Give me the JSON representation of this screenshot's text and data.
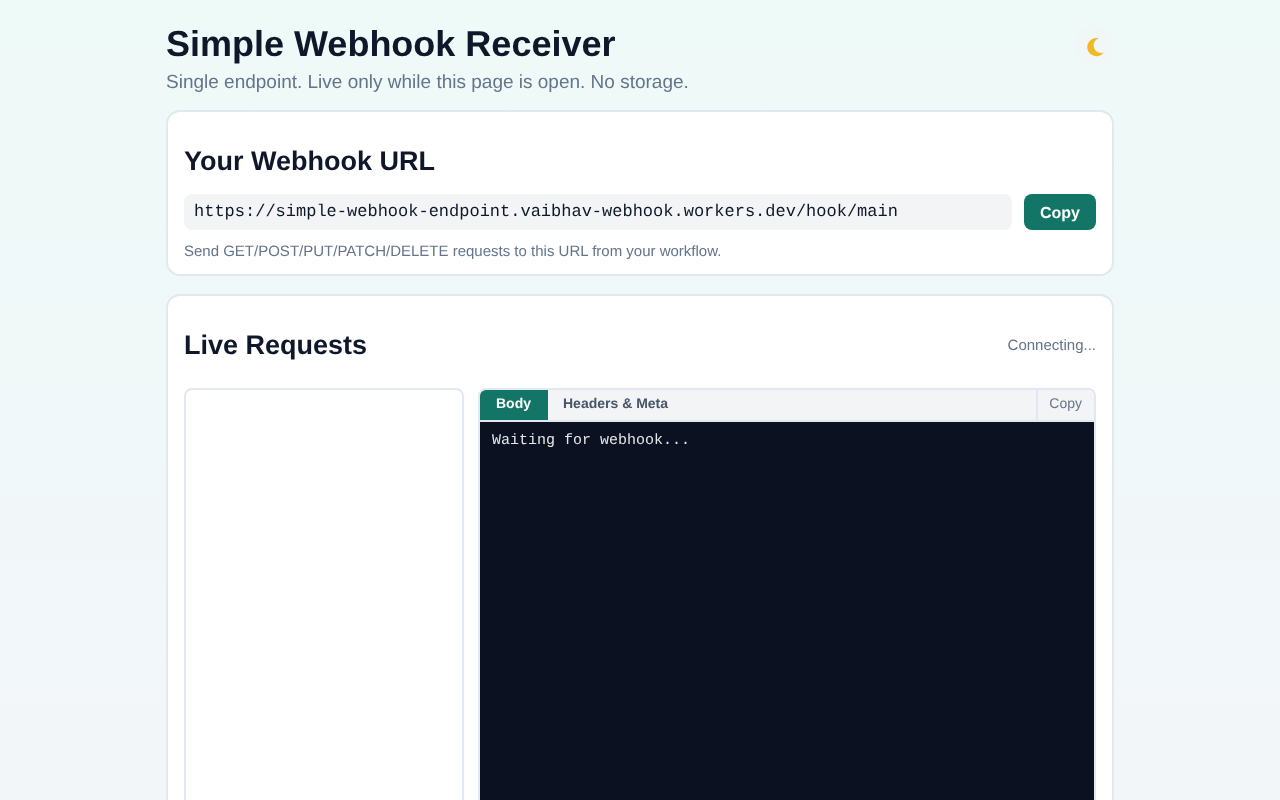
{
  "header": {
    "title": "Simple Webhook Receiver",
    "subtitle": "Single endpoint. Live only while this page is open. No storage."
  },
  "url_card": {
    "title": "Your Webhook URL",
    "url": "https://simple-webhook-endpoint.vaibhav-webhook.workers.dev/hook/main",
    "copy_button": "Copy",
    "hint": "Send GET/POST/PUT/PATCH/DELETE requests to this URL from your workflow."
  },
  "live_card": {
    "title": "Live Requests",
    "status": "Connecting...",
    "tabs": [
      {
        "label": "Body",
        "selected": true
      },
      {
        "label": "Headers & Meta",
        "selected": false
      }
    ],
    "copy_button": "Copy",
    "output": "Waiting for webhook..."
  }
}
